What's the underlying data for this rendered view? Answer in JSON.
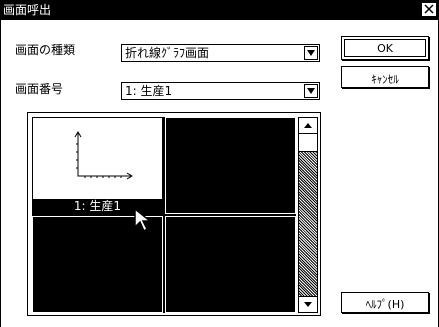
{
  "window": {
    "title": "画面呼出"
  },
  "fields": {
    "screen_type": {
      "label": "画面の種類",
      "value": "折れ線ｸﾞﾗﾌ画面"
    },
    "screen_number": {
      "label": "画面番号",
      "value": "1: 生産1"
    }
  },
  "buttons": {
    "ok": "OK",
    "cancel": "ｷｬﾝｾﾙ",
    "help": "ﾍﾙﾌﾟ(H)"
  },
  "preview": {
    "cells": [
      {
        "caption": "1: 生産1",
        "selected": true
      },
      {
        "caption": "",
        "selected": false
      },
      {
        "caption": "",
        "selected": false
      },
      {
        "caption": "",
        "selected": false
      }
    ]
  },
  "icons": [
    "close-icon",
    "dropdown-arrow-icon",
    "scroll-up-icon",
    "scroll-down-icon",
    "mouse-cursor-icon",
    "line-graph-thumbnail-icon"
  ]
}
